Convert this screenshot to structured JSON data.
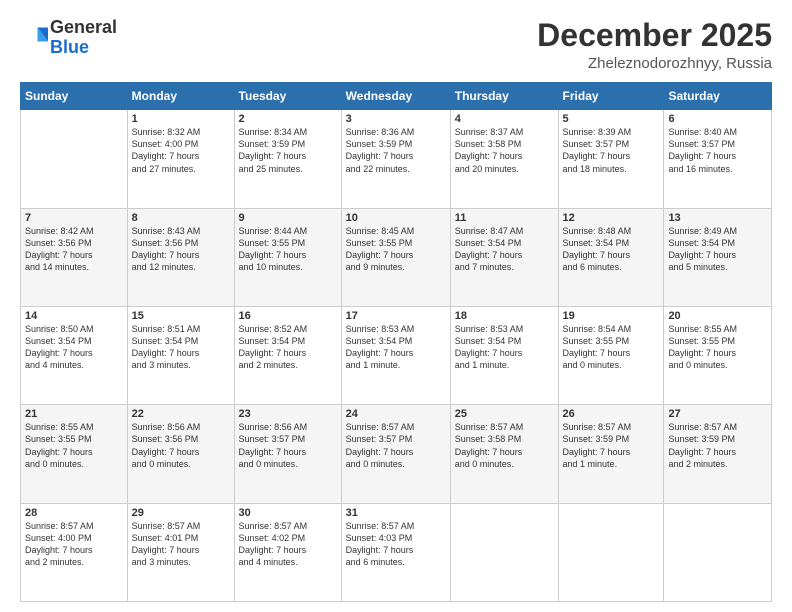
{
  "header": {
    "logo_general": "General",
    "logo_blue": "Blue",
    "main_title": "December 2025",
    "subtitle": "Zheleznodorozhnyy, Russia"
  },
  "calendar": {
    "days_of_week": [
      "Sunday",
      "Monday",
      "Tuesday",
      "Wednesday",
      "Thursday",
      "Friday",
      "Saturday"
    ],
    "weeks": [
      {
        "days": [
          {
            "number": "",
            "info": ""
          },
          {
            "number": "1",
            "info": "Sunrise: 8:32 AM\nSunset: 4:00 PM\nDaylight: 7 hours\nand 27 minutes."
          },
          {
            "number": "2",
            "info": "Sunrise: 8:34 AM\nSunset: 3:59 PM\nDaylight: 7 hours\nand 25 minutes."
          },
          {
            "number": "3",
            "info": "Sunrise: 8:36 AM\nSunset: 3:59 PM\nDaylight: 7 hours\nand 22 minutes."
          },
          {
            "number": "4",
            "info": "Sunrise: 8:37 AM\nSunset: 3:58 PM\nDaylight: 7 hours\nand 20 minutes."
          },
          {
            "number": "5",
            "info": "Sunrise: 8:39 AM\nSunset: 3:57 PM\nDaylight: 7 hours\nand 18 minutes."
          },
          {
            "number": "6",
            "info": "Sunrise: 8:40 AM\nSunset: 3:57 PM\nDaylight: 7 hours\nand 16 minutes."
          }
        ]
      },
      {
        "days": [
          {
            "number": "7",
            "info": "Sunrise: 8:42 AM\nSunset: 3:56 PM\nDaylight: 7 hours\nand 14 minutes."
          },
          {
            "number": "8",
            "info": "Sunrise: 8:43 AM\nSunset: 3:56 PM\nDaylight: 7 hours\nand 12 minutes."
          },
          {
            "number": "9",
            "info": "Sunrise: 8:44 AM\nSunset: 3:55 PM\nDaylight: 7 hours\nand 10 minutes."
          },
          {
            "number": "10",
            "info": "Sunrise: 8:45 AM\nSunset: 3:55 PM\nDaylight: 7 hours\nand 9 minutes."
          },
          {
            "number": "11",
            "info": "Sunrise: 8:47 AM\nSunset: 3:54 PM\nDaylight: 7 hours\nand 7 minutes."
          },
          {
            "number": "12",
            "info": "Sunrise: 8:48 AM\nSunset: 3:54 PM\nDaylight: 7 hours\nand 6 minutes."
          },
          {
            "number": "13",
            "info": "Sunrise: 8:49 AM\nSunset: 3:54 PM\nDaylight: 7 hours\nand 5 minutes."
          }
        ]
      },
      {
        "days": [
          {
            "number": "14",
            "info": "Sunrise: 8:50 AM\nSunset: 3:54 PM\nDaylight: 7 hours\nand 4 minutes."
          },
          {
            "number": "15",
            "info": "Sunrise: 8:51 AM\nSunset: 3:54 PM\nDaylight: 7 hours\nand 3 minutes."
          },
          {
            "number": "16",
            "info": "Sunrise: 8:52 AM\nSunset: 3:54 PM\nDaylight: 7 hours\nand 2 minutes."
          },
          {
            "number": "17",
            "info": "Sunrise: 8:53 AM\nSunset: 3:54 PM\nDaylight: 7 hours\nand 1 minute."
          },
          {
            "number": "18",
            "info": "Sunrise: 8:53 AM\nSunset: 3:54 PM\nDaylight: 7 hours\nand 1 minute."
          },
          {
            "number": "19",
            "info": "Sunrise: 8:54 AM\nSunset: 3:55 PM\nDaylight: 7 hours\nand 0 minutes."
          },
          {
            "number": "20",
            "info": "Sunrise: 8:55 AM\nSunset: 3:55 PM\nDaylight: 7 hours\nand 0 minutes."
          }
        ]
      },
      {
        "days": [
          {
            "number": "21",
            "info": "Sunrise: 8:55 AM\nSunset: 3:55 PM\nDaylight: 7 hours\nand 0 minutes."
          },
          {
            "number": "22",
            "info": "Sunrise: 8:56 AM\nSunset: 3:56 PM\nDaylight: 7 hours\nand 0 minutes."
          },
          {
            "number": "23",
            "info": "Sunrise: 8:56 AM\nSunset: 3:57 PM\nDaylight: 7 hours\nand 0 minutes."
          },
          {
            "number": "24",
            "info": "Sunrise: 8:57 AM\nSunset: 3:57 PM\nDaylight: 7 hours\nand 0 minutes."
          },
          {
            "number": "25",
            "info": "Sunrise: 8:57 AM\nSunset: 3:58 PM\nDaylight: 7 hours\nand 0 minutes."
          },
          {
            "number": "26",
            "info": "Sunrise: 8:57 AM\nSunset: 3:59 PM\nDaylight: 7 hours\nand 1 minute."
          },
          {
            "number": "27",
            "info": "Sunrise: 8:57 AM\nSunset: 3:59 PM\nDaylight: 7 hours\nand 2 minutes."
          }
        ]
      },
      {
        "days": [
          {
            "number": "28",
            "info": "Sunrise: 8:57 AM\nSunset: 4:00 PM\nDaylight: 7 hours\nand 2 minutes."
          },
          {
            "number": "29",
            "info": "Sunrise: 8:57 AM\nSunset: 4:01 PM\nDaylight: 7 hours\nand 3 minutes."
          },
          {
            "number": "30",
            "info": "Sunrise: 8:57 AM\nSunset: 4:02 PM\nDaylight: 7 hours\nand 4 minutes."
          },
          {
            "number": "31",
            "info": "Sunrise: 8:57 AM\nSunset: 4:03 PM\nDaylight: 7 hours\nand 6 minutes."
          },
          {
            "number": "",
            "info": ""
          },
          {
            "number": "",
            "info": ""
          },
          {
            "number": "",
            "info": ""
          }
        ]
      }
    ]
  }
}
